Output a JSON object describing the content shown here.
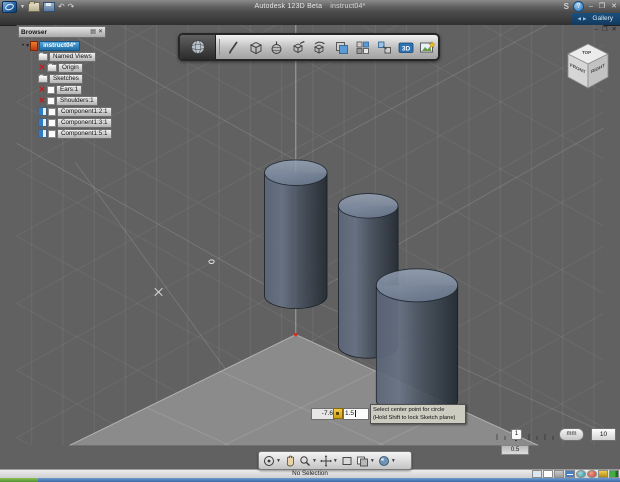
{
  "title_bar": {
    "app_name": "Autodesk 123D Beta",
    "doc_name": "instruct04*",
    "controls": {
      "minimize": "–",
      "restore": "❒",
      "close": "✕"
    }
  },
  "menustrip": {
    "arrow_left": "◀",
    "arrow_right": "▶",
    "gallery_label": "Gallery"
  },
  "doc_window": {
    "controls": {
      "minimize": "–",
      "restore": "❒",
      "close": "✕"
    }
  },
  "browser": {
    "header": "Browser",
    "header_icons": [
      "panel-menu-icon",
      "close-icon"
    ],
    "items": [
      {
        "label": "instruct04*",
        "icon": "document-icon",
        "selected": true
      },
      {
        "label": "Named Views",
        "icon": "folder-icon"
      },
      {
        "label": "Origin",
        "icon": "folder-icon",
        "toggle": "red-x"
      },
      {
        "label": "Sketches",
        "icon": "folder-icon"
      },
      {
        "label": "Ears:1",
        "icon": "checkbox",
        "toggle": "red-x"
      },
      {
        "label": "Shoulders:1",
        "icon": "checkbox",
        "toggle": "red-x"
      },
      {
        "label": "Component1:2:1",
        "icon": "checkbox",
        "toggle": "component-visible"
      },
      {
        "label": "Component1:3:1",
        "icon": "checkbox",
        "toggle": "component-visible"
      },
      {
        "label": "Component1:5:1",
        "icon": "checkbox",
        "toggle": "component-visible"
      }
    ]
  },
  "toolbar": {
    "tools": [
      "app-menu-sphere",
      "sketch-pencil",
      "primitive-box",
      "primitive-sphere",
      "move-transform",
      "revolve-sweep",
      "pattern",
      "combine-grid",
      "group-link",
      "text-3d",
      "insert-picture"
    ]
  },
  "viewcube": {
    "top": "TOP",
    "front": "FRONT",
    "right": "RIGHT"
  },
  "inputs": {
    "x_value": "-7.6",
    "y_value": "1.5"
  },
  "tooltip": {
    "line1": "Select center point for circle",
    "line2": "(Hold Shift to lock Sketch plane)"
  },
  "scale_widget": {
    "marker": "1",
    "snap": "0.5",
    "unit": "mm",
    "grid_size": "10"
  },
  "status_bar": {
    "message": "No Selection"
  },
  "colors": {
    "viewport_background": "#616161",
    "floor_plane": "#8b8b8b",
    "cylinder_top": "#8796ab",
    "cylinder_body": "#3d4755",
    "selection_blue": "#2274ae",
    "gallery_tab_blue": "#17466e",
    "origin_red": "#d23222",
    "tooltip_gray": "#ccccc1"
  }
}
